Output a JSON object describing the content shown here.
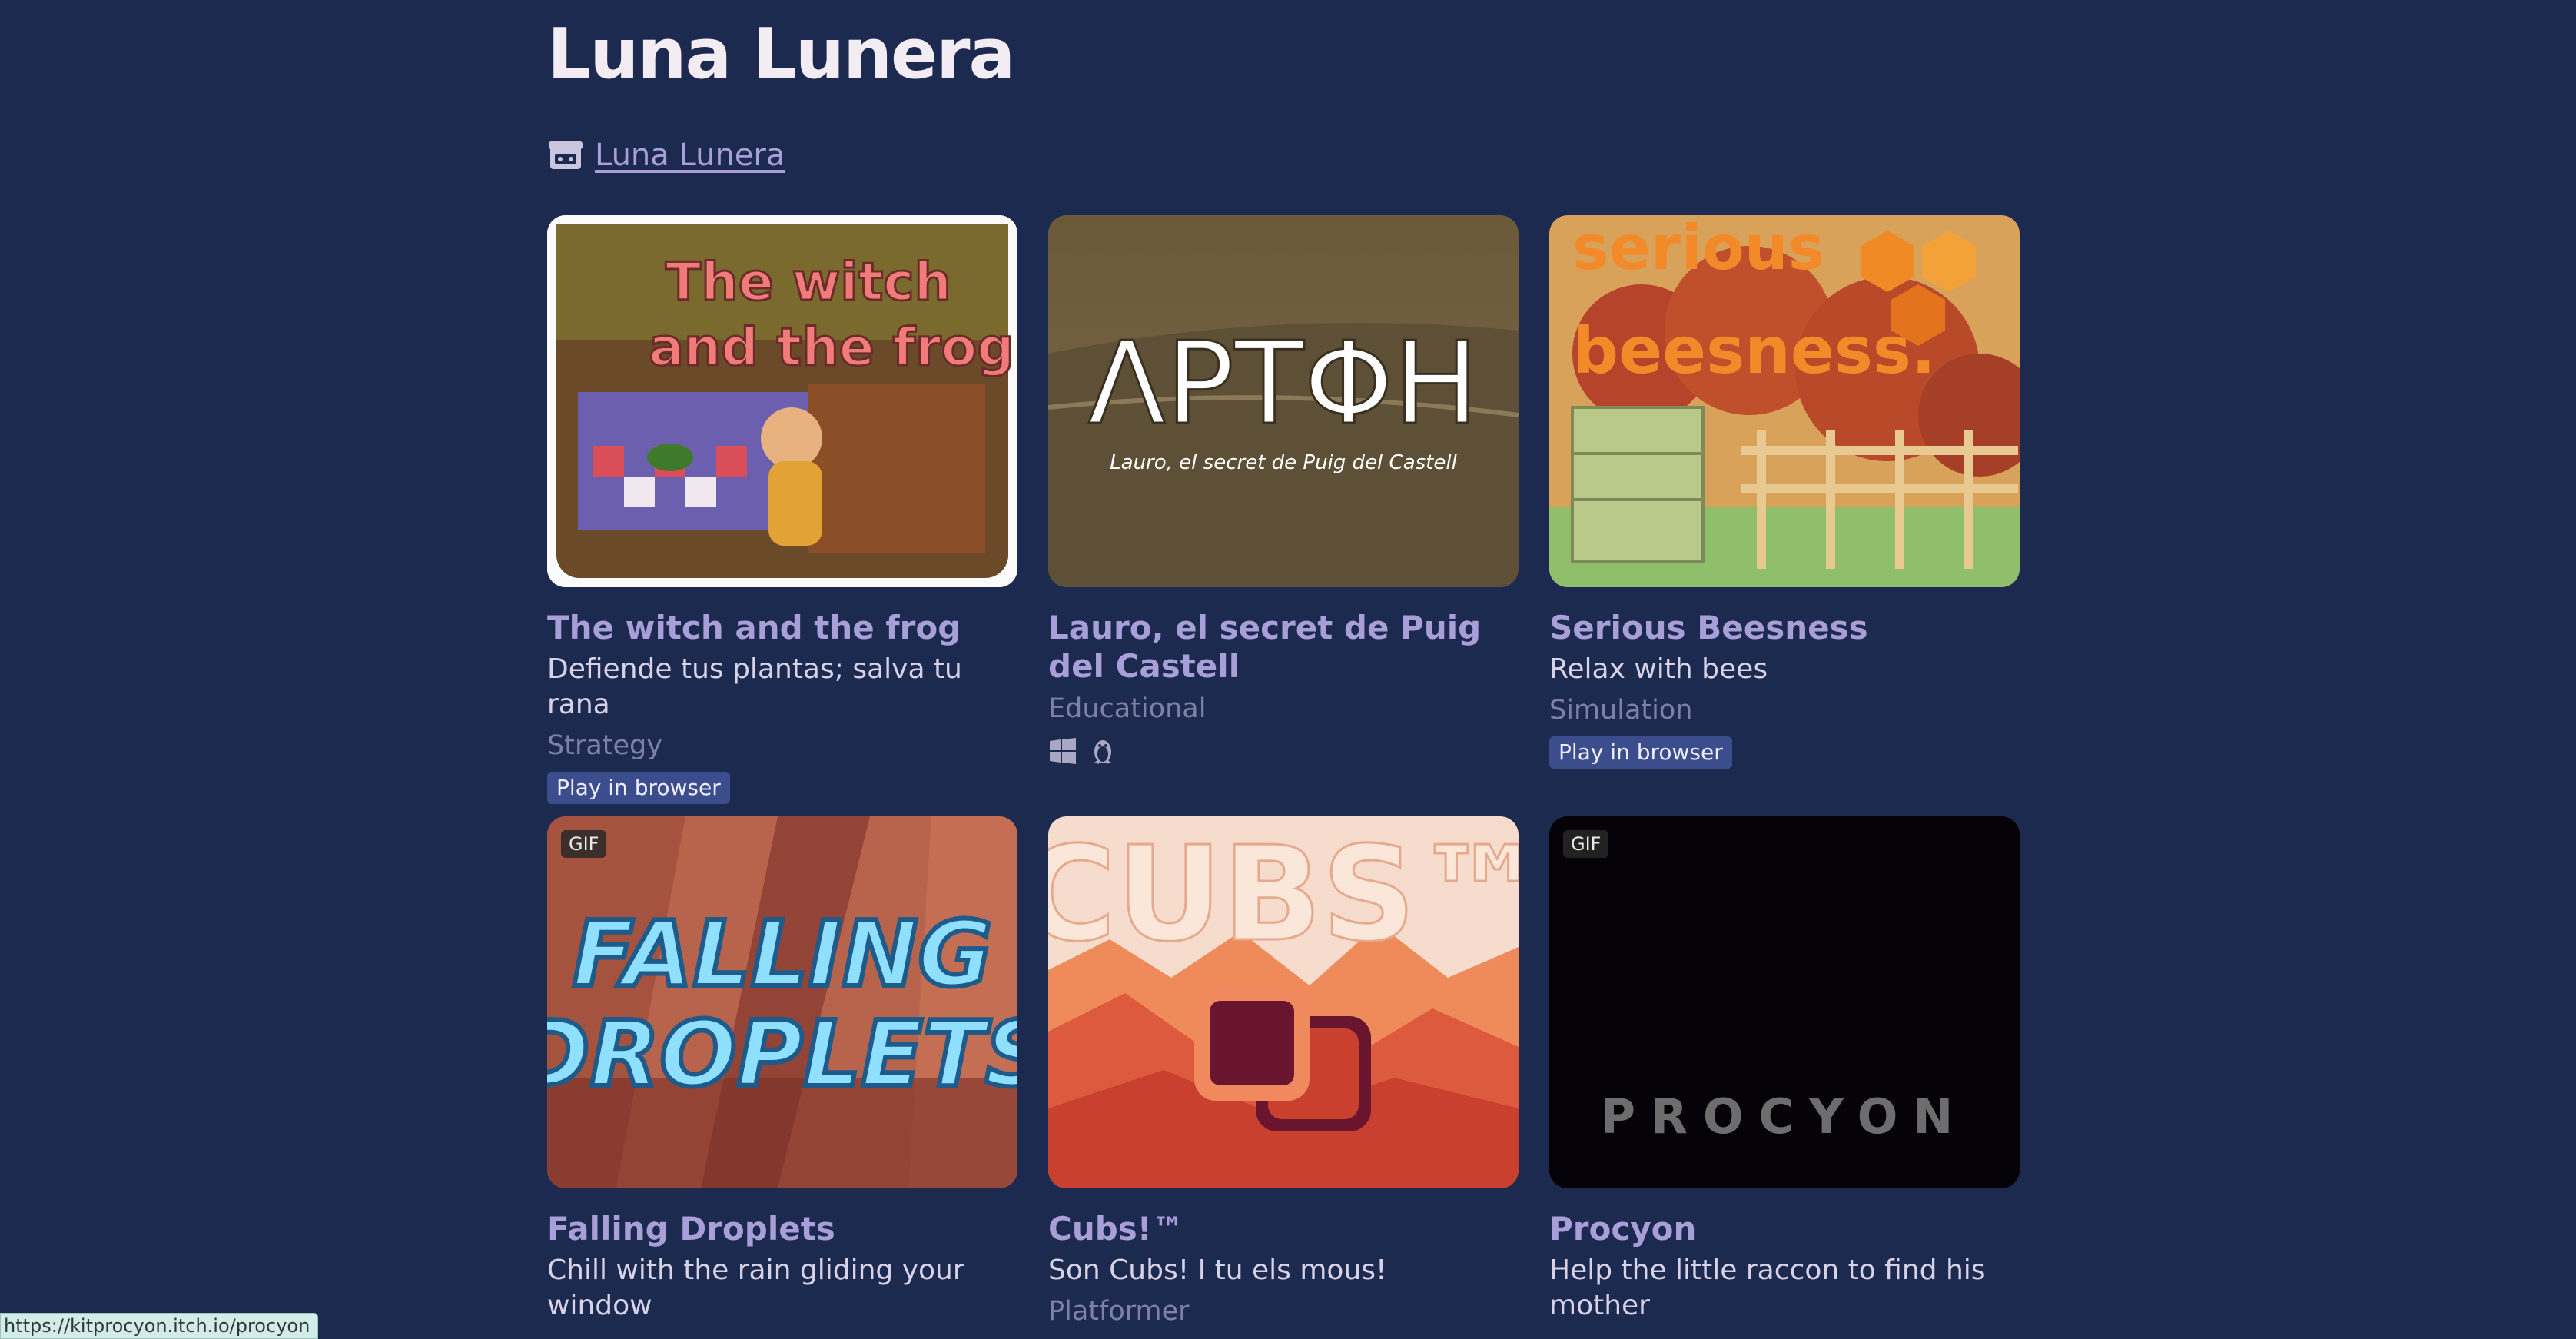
{
  "header": {
    "title": "Luna Lunera",
    "profile_link": "Luna Lunera"
  },
  "colors": {
    "background": "#1d2a4f",
    "title": "#f4ecf3",
    "link": "#a89ed8",
    "badge": "#3c4d8e"
  },
  "games": [
    {
      "title": "The witch and the frog",
      "description": "Defiende tus plantas; salva tu rana",
      "genre": "Strategy",
      "badge": "Play in browser",
      "thumb_text": [
        "The witch",
        "and the frog"
      ]
    },
    {
      "title": "Lauro, el secret de Puig del Castell",
      "description": "",
      "genre": "Educational",
      "platforms": [
        "windows-icon",
        "linux-icon"
      ],
      "thumb_text": [
        "ΛΡΤΦΗ",
        "Lauro, el secret de Puig del Castell"
      ]
    },
    {
      "title": "Serious Beesness",
      "description": "Relax with bees",
      "genre": "Simulation",
      "badge": "Play in browser",
      "thumb_text": [
        "serious",
        "beesness."
      ]
    },
    {
      "title": "Falling Droplets",
      "description": "Chill with the rain gliding your window",
      "genre": "",
      "gif": "GIF",
      "thumb_text": [
        "FALLING",
        "DROPLETS"
      ]
    },
    {
      "title": "Cubs!™",
      "description": "Son Cubs! I tu els mous!",
      "genre": "Platformer",
      "thumb_text": [
        "CUBS™"
      ]
    },
    {
      "title": "Procyon",
      "description": "Help the little raccon to find his mother",
      "genre": "",
      "gif": "GIF",
      "thumb_text": [
        "PROCYON"
      ]
    }
  ],
  "status_bar": "https://kitprocyon.itch.io/procyon"
}
